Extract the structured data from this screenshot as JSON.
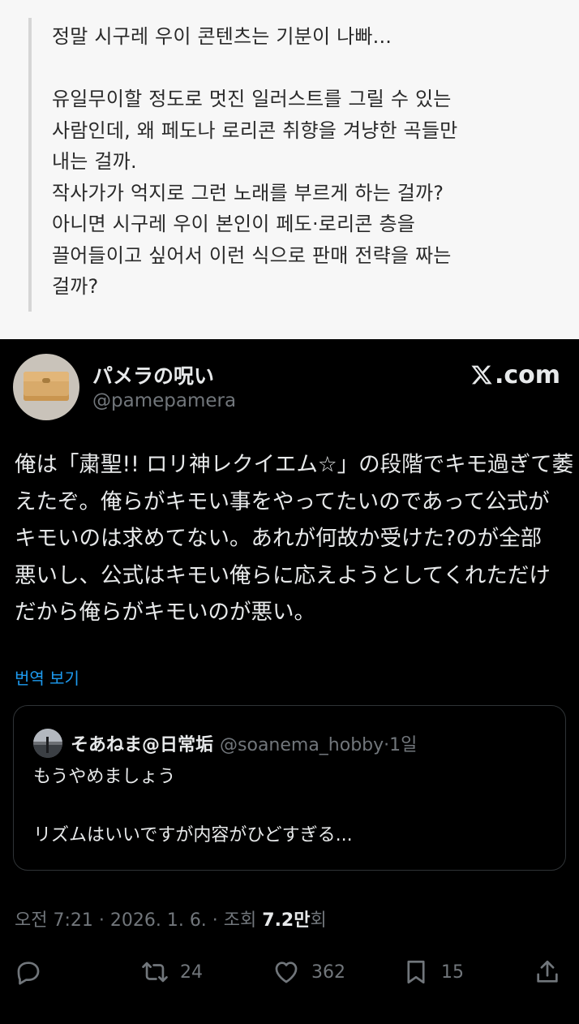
{
  "quote": {
    "lines": [
      "정말 시구레 우이 콘텐츠는 기분이 나빠...",
      "",
      "유일무이할 정도로 멋진 일러스트를 그릴 수 있는",
      "사람인데, 왜 페도나 로리콘 취향을 겨냥한 곡들만",
      "내는 걸까.",
      "작사가가 억지로 그런 노래를 부르게 하는 걸까?",
      "아니면 시구레 우이 본인이 페도·로리콘 층을",
      "끌어들이고 싶어서 이런 식으로 판매 전략을 짜는",
      "걸까?"
    ]
  },
  "tweet": {
    "display_name": "パメラの呪い",
    "handle": "@pamepamera",
    "brand": ".com",
    "body_lines": [
      "俺は「粛聖!! ロリ神レクイエム☆」の段階でキモ過ぎて萎",
      "えたぞ。俺らがキモい事をやってたいのであって公式が",
      "キモいのは求めてない。あれが何故か受けた?のが全部",
      "悪いし、公式はキモい俺らに応えようとしてくれただけ",
      "だから俺らがキモいのが悪い。"
    ],
    "translate_label": "번역 보기",
    "quoted": {
      "name": "そあねま@日常垢",
      "meta": "@soanema_hobby·1일",
      "lines": [
        "もうやめましょう",
        "",
        "リズムはいいですが内容がひどすぎる..."
      ]
    },
    "timestamp_prefix": "오전 7:21 · 2026. 1. 6. · 조회 ",
    "views": "7.2만",
    "views_suffix": "회",
    "actions": {
      "reply_icon": "reply-icon",
      "retweet_count": "24",
      "like_count": "362",
      "bookmark_count": "15",
      "share_icon": "share-icon"
    }
  },
  "colors": {
    "quote_bg": "#f7f7f7",
    "tweet_bg": "#000000",
    "link": "#1d9bf0",
    "muted": "#71767b"
  }
}
